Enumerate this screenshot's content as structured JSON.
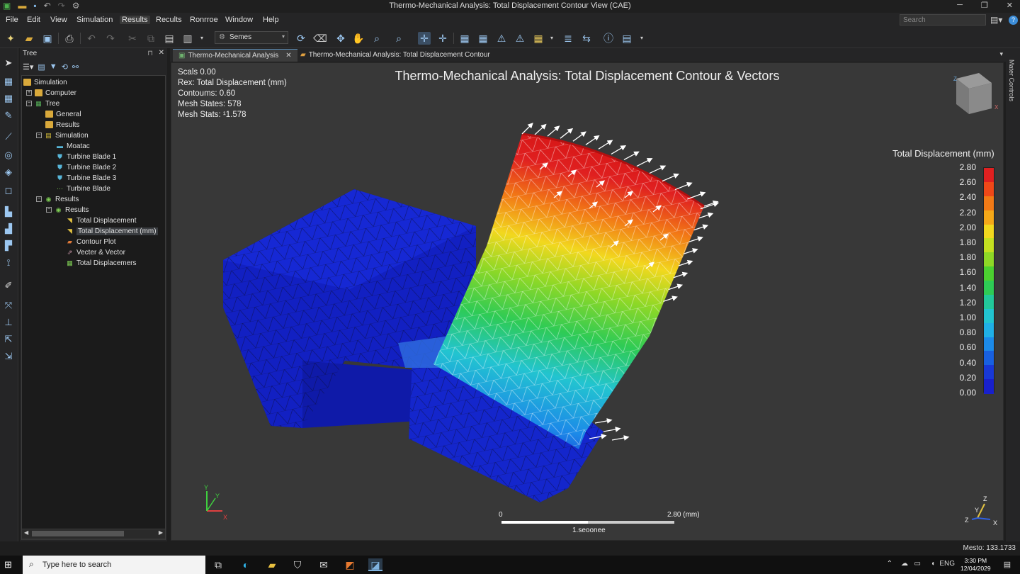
{
  "window": {
    "title": "Thermo-Mechanical Analysis: Total Displacement Contour View (CAE)"
  },
  "menu": [
    "File",
    "Edit",
    "View",
    "Simulation",
    "Results",
    "Recults",
    "Ronrroe",
    "Window",
    "Help"
  ],
  "search": {
    "placeholder": "Search"
  },
  "toolbar": {
    "selector_value": "Semes"
  },
  "tree": {
    "header": "Tree",
    "nodes": [
      {
        "label": "Simulation",
        "icon": "folder-icon"
      },
      {
        "label": "Computer",
        "icon": "folder-icon"
      },
      {
        "label": "Tree",
        "icon": "grid-icon"
      },
      {
        "label": "General",
        "icon": "folder-icon"
      },
      {
        "label": "Results",
        "icon": "folder-icon"
      },
      {
        "label": "Simulation",
        "icon": "grid-icon"
      },
      {
        "label": "Moatac",
        "icon": "material-icon"
      },
      {
        "label": "Turbine Blade 1",
        "icon": "blade-icon"
      },
      {
        "label": "Turbine Blade 2",
        "icon": "blade-icon"
      },
      {
        "label": "Turbine Blade 3",
        "icon": "blade-icon"
      },
      {
        "label": "Turbine Blade",
        "icon": "mesh-icon"
      },
      {
        "label": "Results",
        "icon": "results-icon"
      },
      {
        "label": "Results",
        "icon": "results-icon"
      },
      {
        "label": "Total Displacement",
        "icon": "displacement-icon"
      },
      {
        "label": "Total Displacement (mm)",
        "icon": "displacement-icon"
      },
      {
        "label": "Contour Plot",
        "icon": "contour-icon"
      },
      {
        "label": "Vecter & Vector",
        "icon": "vector-icon"
      },
      {
        "label": "Total Displacemers",
        "icon": "table-icon"
      }
    ]
  },
  "tabs": [
    {
      "label": "Thermo-Mechanical Analysis"
    },
    {
      "label": "Thermo-Mechanical Analysis: Total Displacement Contour"
    }
  ],
  "viewport": {
    "title": "Thermo-Mechanical Analysis: Total Displacement Contour & Vectors",
    "info": [
      "Scals 0.00",
      "Rex: Total Displacement (mm)",
      "Contoums: 0.60",
      "Mesh States: 578",
      "Mesh Stats: ¹1.578"
    ],
    "legend": {
      "title": "Total Displacement (mm)",
      "values": [
        "2.80",
        "2.60",
        "2.40",
        "2.20",
        "2.00",
        "1.80",
        "1.80",
        "1.60",
        "1.40",
        "1.20",
        "1.00",
        "0.80",
        "0.60",
        "0.40",
        "0.20",
        "0.00"
      ],
      "colors": [
        "#e02020",
        "#f04818",
        "#f27a16",
        "#f5a818",
        "#f2d81e",
        "#c4e020",
        "#8ed826",
        "#4cd030",
        "#2ecb55",
        "#22c89a",
        "#22c4d0",
        "#20b0e6",
        "#1c8ae8",
        "#1860e0",
        "#1838d6",
        "#1820cc"
      ]
    },
    "scale": {
      "low": "0",
      "high": "2.80 (mm)",
      "caption": "1.seoonee"
    },
    "axis_left": {
      "x": "X",
      "y": "Y"
    },
    "axis_right": {
      "x": "X",
      "y": "Y",
      "z": "Z"
    }
  },
  "right_panel": {
    "label": "Mater Controls"
  },
  "status": {
    "text": "Mesto: 133.1733"
  },
  "taskbar": {
    "search_placeholder": "Type here to search",
    "lang": "ENG",
    "time": "3:30 PM",
    "date": "12/04/2029"
  }
}
